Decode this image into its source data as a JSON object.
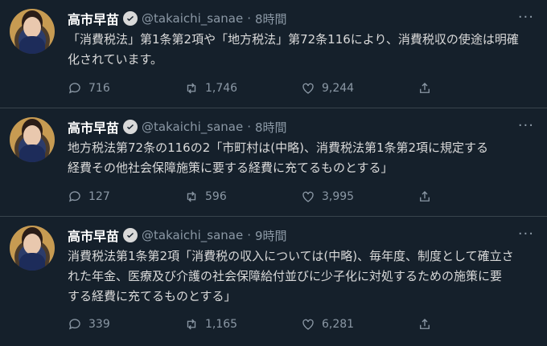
{
  "tweets": [
    {
      "name": "高市早苗",
      "handle": "@takaichi_sanae",
      "separator": "·",
      "time": "8時間",
      "text": "「消費税法」第1条第2項や「地方税法」第72条116により、消費税収の使途は明確\n化されています。",
      "reply_count": "716",
      "retweet_count": "1,746",
      "like_count": "9,244"
    },
    {
      "name": "高市早苗",
      "handle": "@takaichi_sanae",
      "separator": "·",
      "time": "8時間",
      "text": "地方税法第72条の116の2「市町村は(中略)、消費税法第1条第2項に規定する\n経費その他社会保障施策に要する経費に充てるものとする」",
      "reply_count": "127",
      "retweet_count": "596",
      "like_count": "3,995"
    },
    {
      "name": "高市早苗",
      "handle": "@takaichi_sanae",
      "separator": "·",
      "time": "9時間",
      "text": "消費税法第1条第2項「消費税の収入については(中略)、毎年度、制度として確立さ\nれた年金、医療及び介護の社会保障給付並びに少子化に対処するための施策に要\nする経費に充てるものとする」",
      "reply_count": "339",
      "retweet_count": "1,165",
      "like_count": "6,281"
    }
  ],
  "icons": {
    "verified": "verified-badge-icon",
    "more": "more-options-icon",
    "reply": "reply-icon",
    "retweet": "retweet-icon",
    "like": "like-icon",
    "share": "share-icon"
  },
  "colors": {
    "background": "#15202b",
    "text": "#d9d9d9",
    "muted": "#8b98a5",
    "divider": "#38444d"
  }
}
